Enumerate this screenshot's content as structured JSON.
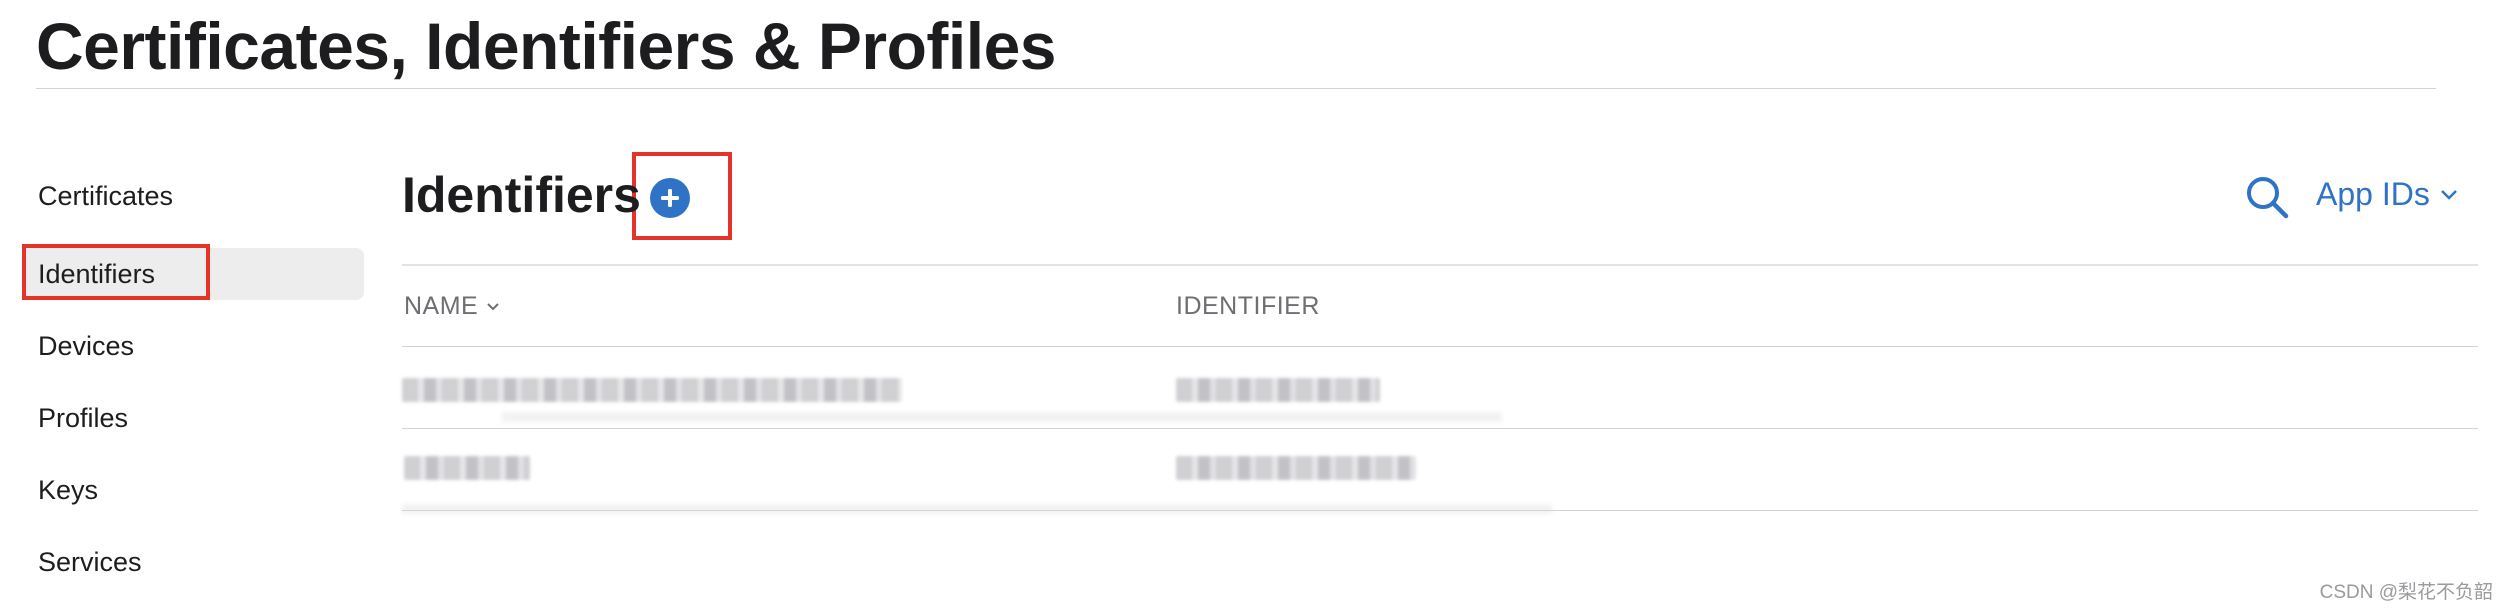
{
  "page": {
    "title": "Certificates, Identifiers & Profiles"
  },
  "sidebar": {
    "items": [
      {
        "label": "Certificates",
        "selected": false
      },
      {
        "label": "Identifiers",
        "selected": true
      },
      {
        "label": "Devices",
        "selected": false
      },
      {
        "label": "Profiles",
        "selected": false
      },
      {
        "label": "Keys",
        "selected": false
      },
      {
        "label": "Services",
        "selected": false
      }
    ]
  },
  "main": {
    "heading": "Identifiers",
    "add_icon": "plus-circle-icon",
    "search_icon": "search-icon",
    "filter": {
      "selected": "App IDs",
      "icon": "chevron-down-icon"
    },
    "columns": [
      {
        "label": "NAME",
        "sortable": true
      },
      {
        "label": "IDENTIFIER",
        "sortable": false
      }
    ],
    "rows_note": "2 rows, contents pixelated"
  },
  "annotations": {
    "highlight_color": "#e53329"
  },
  "colors": {
    "accent": "#2f73c6",
    "text": "#1d1d1f",
    "muted": "#6e6e73",
    "selected_bg": "#ededee"
  },
  "watermark": "CSDN @梨花不负韶"
}
